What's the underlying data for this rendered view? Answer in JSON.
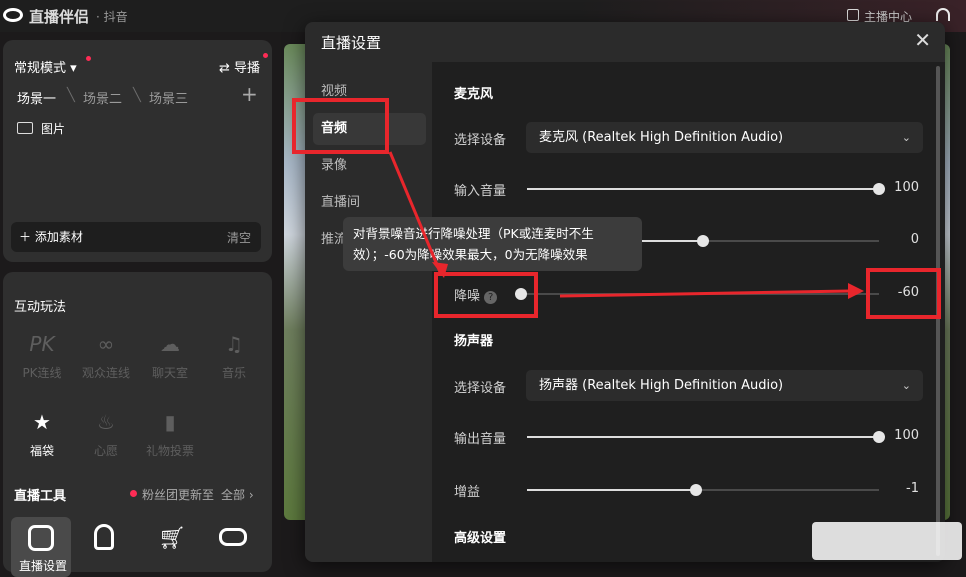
{
  "app": {
    "title": "直播伴侣",
    "platform": "· 抖音",
    "anchor_center": "主播中心"
  },
  "scenes": {
    "mode": "常规模式",
    "director": "导播",
    "tabs": [
      "场景一",
      "场景二",
      "场景三"
    ],
    "sources": [
      {
        "label": "图片"
      }
    ],
    "add_source": "添加素材",
    "clear": "清空"
  },
  "interactive": {
    "title": "互动玩法",
    "items": [
      {
        "label": "PK连线",
        "enabled": false
      },
      {
        "label": "观众连线",
        "enabled": false
      },
      {
        "label": "聊天室",
        "enabled": false
      },
      {
        "label": "音乐",
        "enabled": false
      },
      {
        "label": "福袋",
        "enabled": true
      },
      {
        "label": "心愿",
        "enabled": false
      },
      {
        "label": "礼物投票",
        "enabled": false
      }
    ]
  },
  "tools": {
    "title": "直播工具",
    "notice": "粉丝团更新至",
    "all": "全部",
    "items": [
      {
        "label": "直播设置"
      }
    ]
  },
  "dialog": {
    "title": "直播设置",
    "nav": [
      {
        "label": "视频"
      },
      {
        "label": "音频",
        "active": true
      },
      {
        "label": "录像"
      },
      {
        "label": "直播间"
      },
      {
        "label": "推流"
      }
    ],
    "mic": {
      "section": "麦克风",
      "device_label": "选择设备",
      "device": "麦克风 (Realtek High Definition Audio)",
      "input_volume": {
        "label": "输入音量",
        "value": "100",
        "fraction": 1.0
      },
      "hidden_slider": {
        "value": "0",
        "fraction": 0.5
      },
      "noise": {
        "label": "降噪",
        "value": "-60",
        "fraction": 0.0
      }
    },
    "speaker": {
      "section": "扬声器",
      "device_label": "选择设备",
      "device": "扬声器 (Realtek High Definition Audio)",
      "output_volume": {
        "label": "输出音量",
        "value": "100",
        "fraction": 1.0
      },
      "gain": {
        "label": "增益",
        "value": "-1",
        "fraction": 0.48
      }
    },
    "advanced": "高级设置",
    "tooltip": "对背景噪音进行降噪处理（PK或连麦时不生效）；-60为降噪效果最大，0为无降噪效果"
  },
  "colors": {
    "accent_red": "#e8262c",
    "notice_dot": "#fe2c55"
  }
}
